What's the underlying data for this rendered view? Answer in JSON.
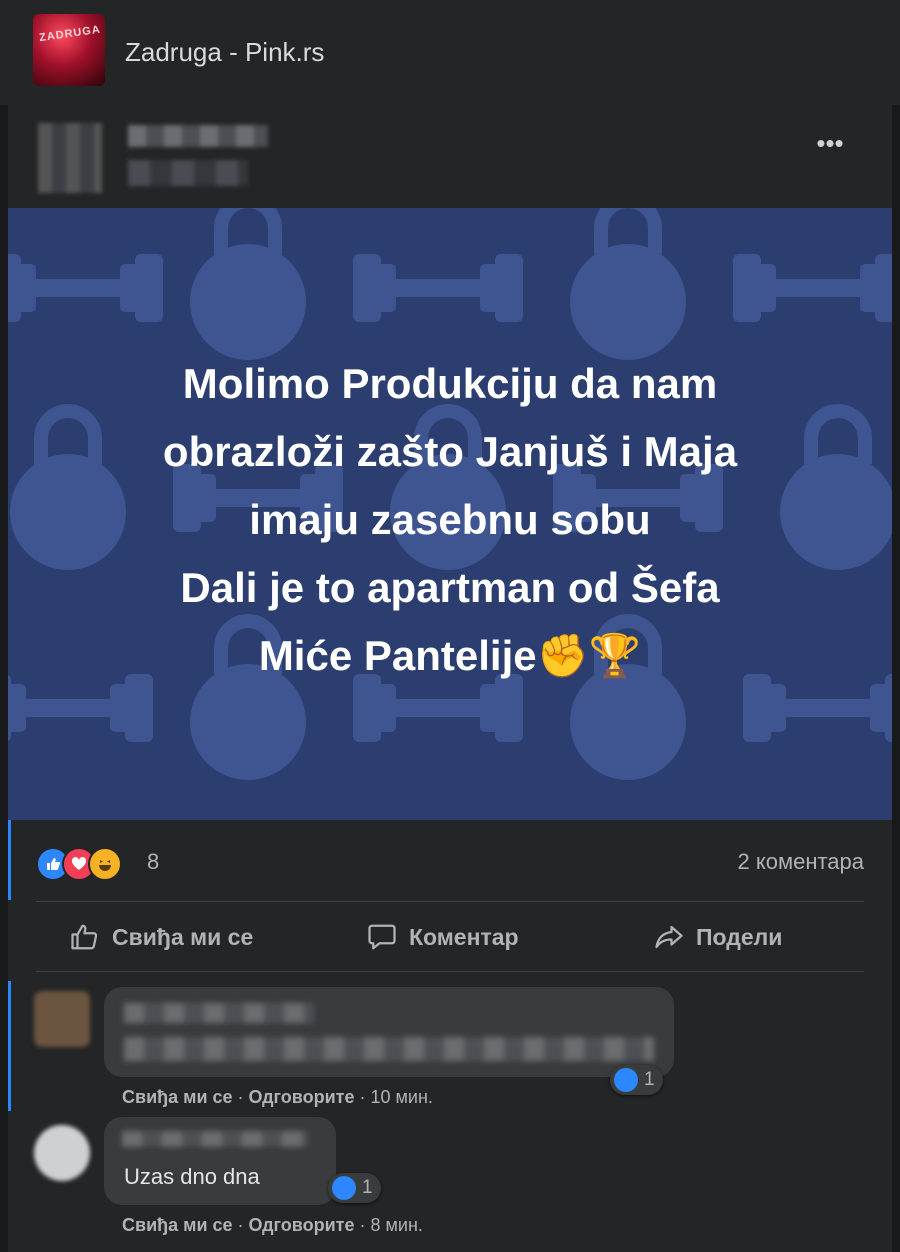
{
  "header": {
    "group_name": "Zadruga - Pink.rs",
    "group_avatar_text": "ZADRUGA"
  },
  "post": {
    "more_icon": "more-horizontal-icon",
    "text": "Molimo Produkciju da nam\nobrazloži zašto Janjuš i Maja\nimaju zasebnu sobu\nDali je to apartman od Šefa\nMiće Pantelije✊🏆",
    "background_color": "#2c3e70",
    "background_pattern": "kettlebell-dumbbell-pattern"
  },
  "stats": {
    "reaction_icons": [
      "like-icon",
      "love-icon",
      "haha-icon"
    ],
    "reaction_count": "8",
    "comments_label": "2 коментара"
  },
  "actions": {
    "like_label": "Свиђа ми се",
    "comment_label": "Коментар",
    "share_label": "Подели"
  },
  "comments": [
    {
      "text_hidden": true,
      "like_count": "1",
      "like_action": "Свиђа ми се",
      "reply_action": "Одговорите",
      "time": "10 мин."
    },
    {
      "text": "Uzas dno dna",
      "like_count": "1",
      "like_action": "Свиђа ми се",
      "reply_action": "Одговорите",
      "time": "8 мин."
    }
  ],
  "colors": {
    "accent": "#2d88ff",
    "card_bg": "#242526",
    "page_bg": "#18191a"
  }
}
